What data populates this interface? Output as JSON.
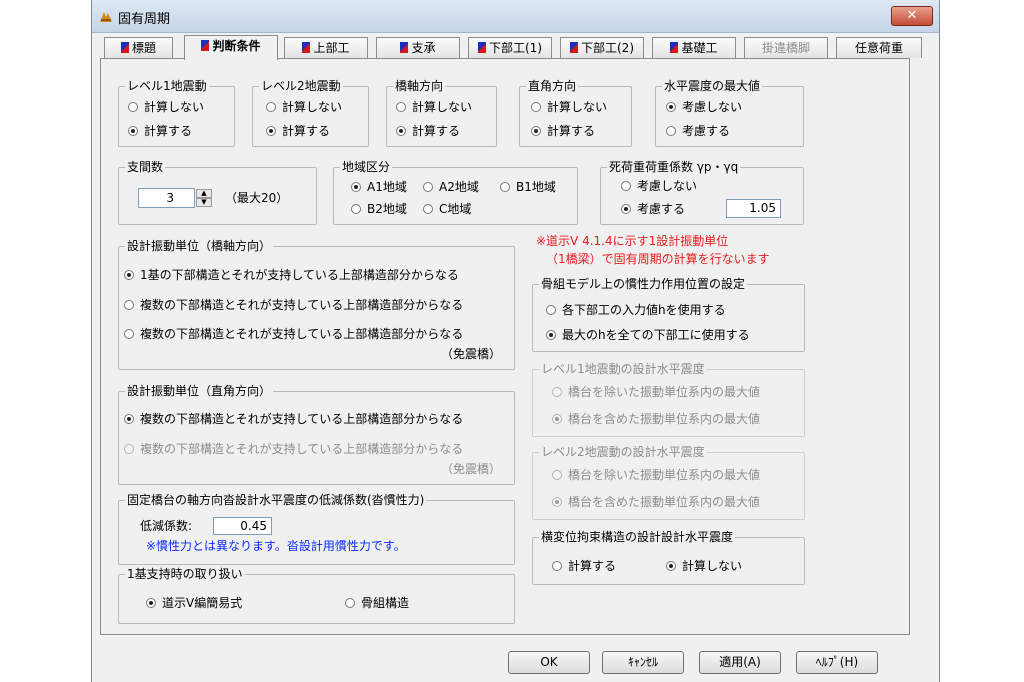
{
  "window": {
    "title": "固有周期",
    "close": "✕"
  },
  "tabs": [
    {
      "label": "標題",
      "icon": "flag-icon"
    },
    {
      "label": "判断条件",
      "icon": "flag-icon",
      "active": true
    },
    {
      "label": "上部工",
      "icon": "flag-icon"
    },
    {
      "label": "支承",
      "icon": "flag-icon"
    },
    {
      "label": "下部工(1)",
      "icon": "flag-icon"
    },
    {
      "label": "下部工(2)",
      "icon": "flag-icon"
    },
    {
      "label": "基礎工",
      "icon": "flag-icon"
    },
    {
      "label": "掛違橋脚",
      "disabled": true
    },
    {
      "label": "任意荷重"
    }
  ],
  "level1": {
    "title": "レベル1地震動",
    "opt1": "計算しない",
    "opt2": "計算する",
    "selected": 2
  },
  "level2": {
    "title": "レベル2地震動",
    "opt1": "計算しない",
    "opt2": "計算する",
    "selected": 2
  },
  "bridge_axis": {
    "title": "橋軸方向",
    "opt1": "計算しない",
    "opt2": "計算する",
    "selected": 2
  },
  "perpendicular": {
    "title": "直角方向",
    "opt1": "計算しない",
    "opt2": "計算する",
    "selected": 2
  },
  "max_horizontal": {
    "title": "水平震度の最大値",
    "opt1": "考慮しない",
    "opt2": "考慮する",
    "selected": 1
  },
  "spans": {
    "title": "支間数",
    "value": "3",
    "max_note": "（最大20）"
  },
  "region": {
    "title": "地域区分",
    "a1": "A1地域",
    "a2": "A2地域",
    "b1": "B1地域",
    "b2": "B2地域",
    "c": "C地域",
    "selected": "A1地域"
  },
  "dead_load": {
    "title": "死荷重荷重係数 γp・γq",
    "opt1": "考慮しない",
    "opt2": "考慮する",
    "value": "1.05",
    "selected": 2
  },
  "note_red": {
    "line1": "※道示Ⅴ 4.1.4に示す1設計振動単位",
    "line2": "（1橋梁）で固有周期の計算を行ないます"
  },
  "unit_axis": {
    "title": "設計振動単位（橋軸方向）",
    "opt1": "1基の下部構造とそれが支持している上部構造部分からなる",
    "opt2": "複数の下部構造とそれが支持している上部構造部分からなる",
    "opt3": "複数の下部構造とそれが支持している上部構造部分からなる",
    "opt3_suffix": "（免震橋）",
    "selected": 1
  },
  "unit_perp": {
    "title": "設計振動単位（直角方向）",
    "opt1": "複数の下部構造とそれが支持している上部構造部分からなる",
    "opt2": "複数の下部構造とそれが支持している上部構造部分からなる",
    "opt2_suffix": "（免震橋）",
    "selected": 1
  },
  "inertia_pos": {
    "title": "骨組モデル上の慣性力作用位置の設定",
    "opt1": "各下部工の入力値hを使用する",
    "opt2": "最大のhを全ての下部工に使用する",
    "selected": 2
  },
  "l1_design": {
    "title": "レベル1地震動の設計水平震度",
    "opt1": "橋台を除いた振動単位系内の最大値",
    "opt2": "橋台を含めた振動単位系内の最大値",
    "selected": 2
  },
  "l2_design": {
    "title": "レベル2地震動の設計水平震度",
    "opt1": "橋台を除いた振動単位系内の最大値",
    "opt2": "橋台を含めた振動単位系内の最大値",
    "selected": 2
  },
  "fixed_abutment": {
    "title": "固定橋台の軸方向沓設計水平震度の低減係数(沓慣性力)",
    "label": "低減係数:",
    "value": "0.45",
    "note": "※慣性力とは異なります。沓設計用慣性力です。"
  },
  "lateral": {
    "title": "横変位拘束構造の設計設計水平震度",
    "opt1": "計算する",
    "opt2": "計算しない",
    "selected": 2
  },
  "single_support": {
    "title": "1基支持時の取り扱い",
    "opt1": "道示Ⅴ編簡易式",
    "opt2": "骨組構造",
    "selected": 1
  },
  "buttons": {
    "ok": "OK",
    "cancel": "ｷｬﾝｾﾙ",
    "apply": "適用(A)",
    "help": "ﾍﾙﾌﾟ(H)"
  }
}
